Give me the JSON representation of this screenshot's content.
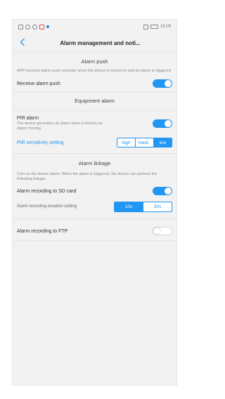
{
  "status_bar": {
    "time": "16:09"
  },
  "header": {
    "title": "Alarm management and noti..."
  },
  "alarm_push": {
    "heading": "Alarm push",
    "description": "APP receives alarm push reminder when the device is turned on and an alarm is triggered",
    "receive_label": "Receive alarm push",
    "receive_enabled": true
  },
  "equipment_alarm": {
    "heading": "Equipment alarm",
    "pir_label": "PIR alarm",
    "pir_description": "The device generates an alarm when it detects an object moving.",
    "pir_enabled": true,
    "sensitivity_label": "PIR sensitivity setting",
    "sensitivity_options": [
      "high",
      "medi..",
      "low"
    ],
    "sensitivity_selected": "low"
  },
  "alarm_linkage": {
    "heading": "Alarm linkage",
    "description": "Turn on the device alarm. When the alarm is triggered, the device can perform the following linkage:",
    "sd_label": "Alarm recording to SD card",
    "sd_enabled": true,
    "duration_label": "Alarm recording duration setting",
    "duration_options": [
      "10s",
      "30s"
    ],
    "duration_selected": "10s",
    "ftp_label": "Alarm recording to FTP",
    "ftp_enabled": false
  },
  "colors": {
    "accent": "#2196f3",
    "background": "#f2f2f2"
  }
}
